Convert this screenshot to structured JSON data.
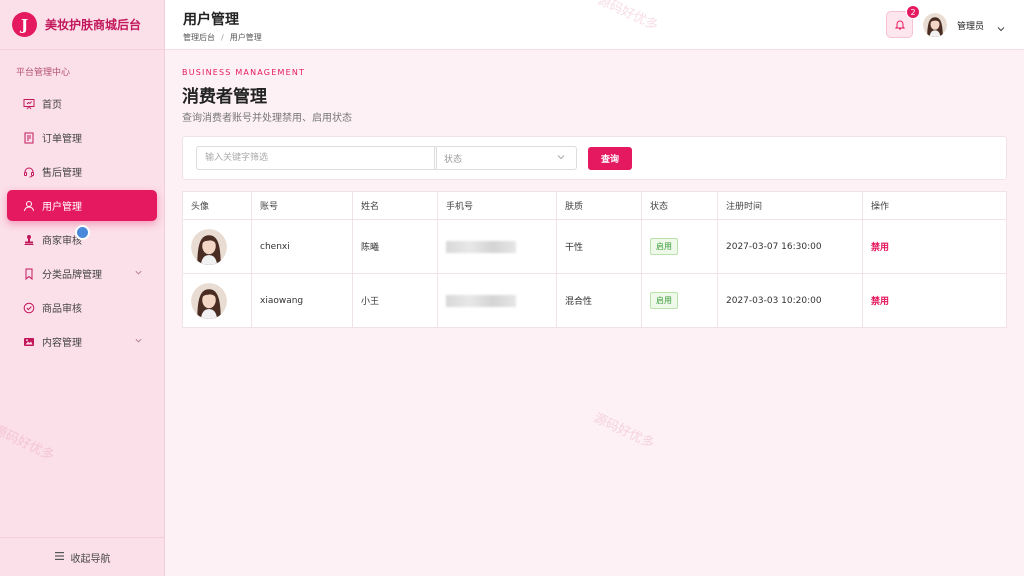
{
  "brand": {
    "logo_letter": "J",
    "name": "美妆护肤商城后台"
  },
  "sidebar": {
    "section_label": "平台管理中心",
    "items": [
      {
        "label": "首页",
        "icon": "chart-board-icon",
        "active": false
      },
      {
        "label": "订单管理",
        "icon": "document-icon",
        "active": false
      },
      {
        "label": "售后管理",
        "icon": "headset-icon",
        "active": false
      },
      {
        "label": "用户管理",
        "icon": "user-icon",
        "active": true
      },
      {
        "label": "商家审核",
        "icon": "stamp-icon",
        "active": false
      },
      {
        "label": "分类品牌管理",
        "icon": "bookmark-icon",
        "active": false,
        "expandable": true
      },
      {
        "label": "商品审核",
        "icon": "check-circle-icon",
        "active": false
      },
      {
        "label": "内容管理",
        "icon": "image-icon",
        "active": false,
        "expandable": true
      }
    ],
    "collapse_label": "收起导航"
  },
  "header": {
    "title": "用户管理",
    "breadcrumb": [
      "管理后台",
      "用户管理"
    ],
    "breadcrumb_sep": "/",
    "notification_count": "2",
    "admin_name": "管理员"
  },
  "page": {
    "eyebrow": "BUSINESS MANAGEMENT",
    "heading": "消费者管理",
    "subheading": "查询消费者账号并处理禁用、启用状态"
  },
  "filter": {
    "keyword_placeholder": "输入关键字筛选",
    "status_placeholder": "状态",
    "query_label": "查询"
  },
  "table": {
    "columns": [
      "头像",
      "账号",
      "姓名",
      "手机号",
      "肤质",
      "状态",
      "注册时间",
      "操作"
    ],
    "rows": [
      {
        "account": "chenxi",
        "name": "陈曦",
        "skin": "干性",
        "status": "启用",
        "registered": "2027-03-07 16:30:00",
        "action": "禁用"
      },
      {
        "account": "xiaowang",
        "name": "小王",
        "skin": "混合性",
        "status": "启用",
        "registered": "2027-03-03 10:20:00",
        "action": "禁用"
      }
    ]
  },
  "watermark": "源码好优多",
  "colors": {
    "accent": "#e5195f",
    "sidebar_bg": "#fbdfe9",
    "page_bg": "#fdf1f5"
  }
}
